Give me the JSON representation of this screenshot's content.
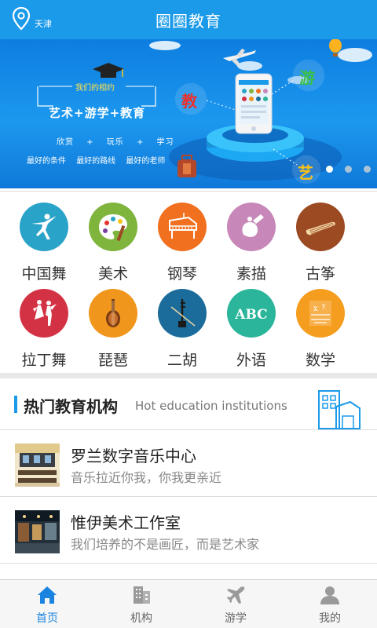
{
  "header": {
    "city": "天津",
    "title": "圈圈教育"
  },
  "banner": {
    "subtitle": "我们的相约",
    "headline": "艺术+游学+教育",
    "words": [
      "欣赏",
      "+",
      "玩乐",
      "+",
      "学习"
    ],
    "slogans": [
      "最好的条件",
      "最好的路线",
      "最好的老师"
    ],
    "circle_chars": {
      "left": "教",
      "right": "游",
      "bottom": "艺"
    },
    "dots": {
      "count": 3,
      "active_index": 0
    }
  },
  "categories": [
    {
      "label": "中国舞",
      "icon": "dancer-icon",
      "color": "#2aa3c8"
    },
    {
      "label": "美术",
      "icon": "palette-icon",
      "color": "#7fb43d"
    },
    {
      "label": "钢琴",
      "icon": "piano-icon",
      "color": "#f0701f"
    },
    {
      "label": "素描",
      "icon": "sketch-icon",
      "color": "#c788b9"
    },
    {
      "label": "古筝",
      "icon": "guzheng-icon",
      "color": "#9c4a22"
    },
    {
      "label": "拉丁舞",
      "icon": "latin-dance-icon",
      "color": "#d33245"
    },
    {
      "label": "琵琶",
      "icon": "pipa-icon",
      "color": "#f1961c"
    },
    {
      "label": "二胡",
      "icon": "erhu-icon",
      "color": "#1b6c9a"
    },
    {
      "label": "外语",
      "icon": "abc-icon",
      "color": "#2bb59a"
    },
    {
      "label": "数学",
      "icon": "math-icon",
      "color": "#f59d1f"
    }
  ],
  "hot": {
    "title": "热门教育机构",
    "subtitle": "Hot education institutions"
  },
  "institutions": [
    {
      "name": "罗兰数字音乐中心",
      "desc": "音乐拉近你我，你我更亲近"
    },
    {
      "name": "惟伊美术工作室",
      "desc": "我们培养的不是画匠，而是艺术家"
    }
  ],
  "nav": [
    {
      "label": "首页",
      "icon": "home-icon",
      "active": true
    },
    {
      "label": "机构",
      "icon": "building-icon",
      "active": false
    },
    {
      "label": "游学",
      "icon": "airplane-icon",
      "active": false
    },
    {
      "label": "我的",
      "icon": "user-icon",
      "active": false
    }
  ],
  "colors": {
    "primary": "#1a9ae8",
    "nav_active": "#1a84e0"
  }
}
